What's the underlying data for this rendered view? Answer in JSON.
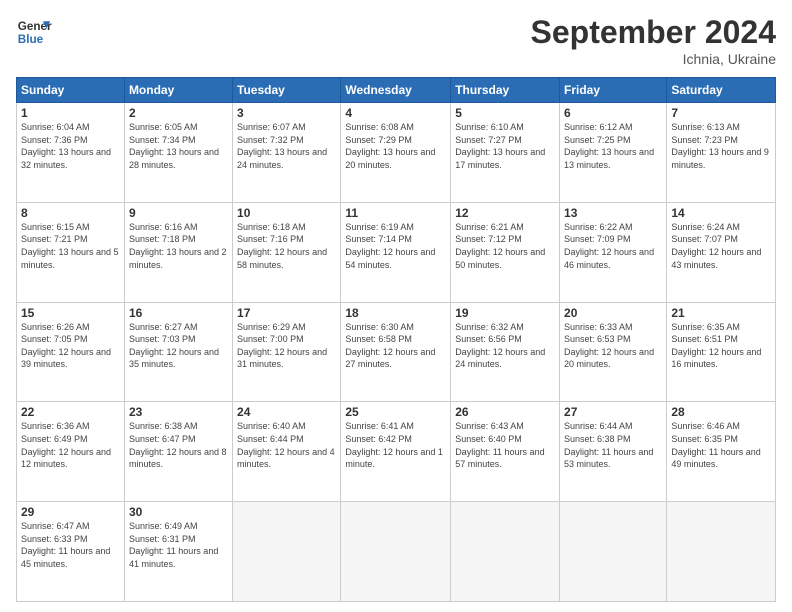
{
  "header": {
    "logo_general": "General",
    "logo_blue": "Blue",
    "month_title": "September 2024",
    "location": "Ichnia, Ukraine"
  },
  "days_of_week": [
    "Sunday",
    "Monday",
    "Tuesday",
    "Wednesday",
    "Thursday",
    "Friday",
    "Saturday"
  ],
  "weeks": [
    [
      {
        "day": "1",
        "sunrise": "6:04 AM",
        "sunset": "7:36 PM",
        "daylight": "13 hours and 32 minutes."
      },
      {
        "day": "2",
        "sunrise": "6:05 AM",
        "sunset": "7:34 PM",
        "daylight": "13 hours and 28 minutes."
      },
      {
        "day": "3",
        "sunrise": "6:07 AM",
        "sunset": "7:32 PM",
        "daylight": "13 hours and 24 minutes."
      },
      {
        "day": "4",
        "sunrise": "6:08 AM",
        "sunset": "7:29 PM",
        "daylight": "13 hours and 20 minutes."
      },
      {
        "day": "5",
        "sunrise": "6:10 AM",
        "sunset": "7:27 PM",
        "daylight": "13 hours and 17 minutes."
      },
      {
        "day": "6",
        "sunrise": "6:12 AM",
        "sunset": "7:25 PM",
        "daylight": "13 hours and 13 minutes."
      },
      {
        "day": "7",
        "sunrise": "6:13 AM",
        "sunset": "7:23 PM",
        "daylight": "13 hours and 9 minutes."
      }
    ],
    [
      {
        "day": "8",
        "sunrise": "6:15 AM",
        "sunset": "7:21 PM",
        "daylight": "13 hours and 5 minutes."
      },
      {
        "day": "9",
        "sunrise": "6:16 AM",
        "sunset": "7:18 PM",
        "daylight": "13 hours and 2 minutes."
      },
      {
        "day": "10",
        "sunrise": "6:18 AM",
        "sunset": "7:16 PM",
        "daylight": "12 hours and 58 minutes."
      },
      {
        "day": "11",
        "sunrise": "6:19 AM",
        "sunset": "7:14 PM",
        "daylight": "12 hours and 54 minutes."
      },
      {
        "day": "12",
        "sunrise": "6:21 AM",
        "sunset": "7:12 PM",
        "daylight": "12 hours and 50 minutes."
      },
      {
        "day": "13",
        "sunrise": "6:22 AM",
        "sunset": "7:09 PM",
        "daylight": "12 hours and 46 minutes."
      },
      {
        "day": "14",
        "sunrise": "6:24 AM",
        "sunset": "7:07 PM",
        "daylight": "12 hours and 43 minutes."
      }
    ],
    [
      {
        "day": "15",
        "sunrise": "6:26 AM",
        "sunset": "7:05 PM",
        "daylight": "12 hours and 39 minutes."
      },
      {
        "day": "16",
        "sunrise": "6:27 AM",
        "sunset": "7:03 PM",
        "daylight": "12 hours and 35 minutes."
      },
      {
        "day": "17",
        "sunrise": "6:29 AM",
        "sunset": "7:00 PM",
        "daylight": "12 hours and 31 minutes."
      },
      {
        "day": "18",
        "sunrise": "6:30 AM",
        "sunset": "6:58 PM",
        "daylight": "12 hours and 27 minutes."
      },
      {
        "day": "19",
        "sunrise": "6:32 AM",
        "sunset": "6:56 PM",
        "daylight": "12 hours and 24 minutes."
      },
      {
        "day": "20",
        "sunrise": "6:33 AM",
        "sunset": "6:53 PM",
        "daylight": "12 hours and 20 minutes."
      },
      {
        "day": "21",
        "sunrise": "6:35 AM",
        "sunset": "6:51 PM",
        "daylight": "12 hours and 16 minutes."
      }
    ],
    [
      {
        "day": "22",
        "sunrise": "6:36 AM",
        "sunset": "6:49 PM",
        "daylight": "12 hours and 12 minutes."
      },
      {
        "day": "23",
        "sunrise": "6:38 AM",
        "sunset": "6:47 PM",
        "daylight": "12 hours and 8 minutes."
      },
      {
        "day": "24",
        "sunrise": "6:40 AM",
        "sunset": "6:44 PM",
        "daylight": "12 hours and 4 minutes."
      },
      {
        "day": "25",
        "sunrise": "6:41 AM",
        "sunset": "6:42 PM",
        "daylight": "12 hours and 1 minute."
      },
      {
        "day": "26",
        "sunrise": "6:43 AM",
        "sunset": "6:40 PM",
        "daylight": "11 hours and 57 minutes."
      },
      {
        "day": "27",
        "sunrise": "6:44 AM",
        "sunset": "6:38 PM",
        "daylight": "11 hours and 53 minutes."
      },
      {
        "day": "28",
        "sunrise": "6:46 AM",
        "sunset": "6:35 PM",
        "daylight": "11 hours and 49 minutes."
      }
    ],
    [
      {
        "day": "29",
        "sunrise": "6:47 AM",
        "sunset": "6:33 PM",
        "daylight": "11 hours and 45 minutes."
      },
      {
        "day": "30",
        "sunrise": "6:49 AM",
        "sunset": "6:31 PM",
        "daylight": "11 hours and 41 minutes."
      },
      null,
      null,
      null,
      null,
      null
    ]
  ]
}
